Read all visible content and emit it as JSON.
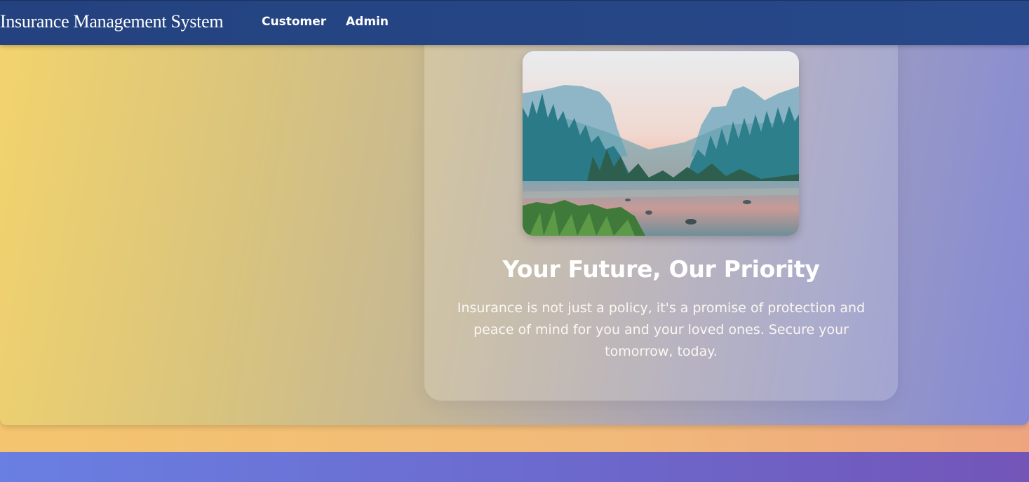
{
  "navbar": {
    "brand": "Insurance Management System",
    "links": [
      {
        "label": "Customer"
      },
      {
        "label": "Admin"
      }
    ]
  },
  "hero": {
    "image_icon": "landscape-photo",
    "title": "Your Future, Our Priority",
    "text": "Insurance is not just a policy, it's a promise of protection and peace of mind for you and your loved ones. Secure your tomorrow, today."
  },
  "colors": {
    "navbar": "#24427f",
    "hero_gradient_start": "#f3d36c",
    "hero_gradient_end": "#8589d4",
    "band": "#f4c56e",
    "footer": "#6c69cd",
    "text": "#ffffff"
  }
}
